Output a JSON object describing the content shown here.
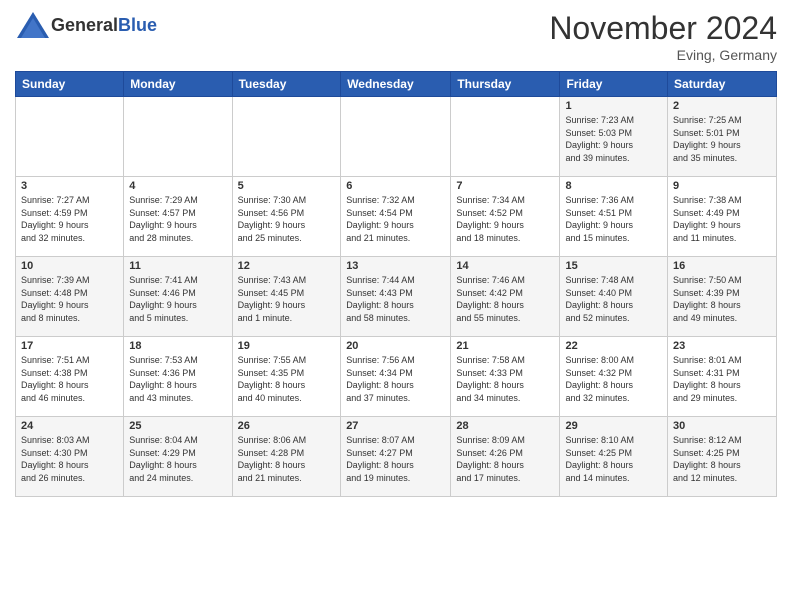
{
  "header": {
    "logo_general": "General",
    "logo_blue": "Blue",
    "month_title": "November 2024",
    "location": "Eving, Germany"
  },
  "days_of_week": [
    "Sunday",
    "Monday",
    "Tuesday",
    "Wednesday",
    "Thursday",
    "Friday",
    "Saturday"
  ],
  "weeks": [
    [
      {
        "day": "",
        "info": ""
      },
      {
        "day": "",
        "info": ""
      },
      {
        "day": "",
        "info": ""
      },
      {
        "day": "",
        "info": ""
      },
      {
        "day": "",
        "info": ""
      },
      {
        "day": "1",
        "info": "Sunrise: 7:23 AM\nSunset: 5:03 PM\nDaylight: 9 hours\nand 39 minutes."
      },
      {
        "day": "2",
        "info": "Sunrise: 7:25 AM\nSunset: 5:01 PM\nDaylight: 9 hours\nand 35 minutes."
      }
    ],
    [
      {
        "day": "3",
        "info": "Sunrise: 7:27 AM\nSunset: 4:59 PM\nDaylight: 9 hours\nand 32 minutes."
      },
      {
        "day": "4",
        "info": "Sunrise: 7:29 AM\nSunset: 4:57 PM\nDaylight: 9 hours\nand 28 minutes."
      },
      {
        "day": "5",
        "info": "Sunrise: 7:30 AM\nSunset: 4:56 PM\nDaylight: 9 hours\nand 25 minutes."
      },
      {
        "day": "6",
        "info": "Sunrise: 7:32 AM\nSunset: 4:54 PM\nDaylight: 9 hours\nand 21 minutes."
      },
      {
        "day": "7",
        "info": "Sunrise: 7:34 AM\nSunset: 4:52 PM\nDaylight: 9 hours\nand 18 minutes."
      },
      {
        "day": "8",
        "info": "Sunrise: 7:36 AM\nSunset: 4:51 PM\nDaylight: 9 hours\nand 15 minutes."
      },
      {
        "day": "9",
        "info": "Sunrise: 7:38 AM\nSunset: 4:49 PM\nDaylight: 9 hours\nand 11 minutes."
      }
    ],
    [
      {
        "day": "10",
        "info": "Sunrise: 7:39 AM\nSunset: 4:48 PM\nDaylight: 9 hours\nand 8 minutes."
      },
      {
        "day": "11",
        "info": "Sunrise: 7:41 AM\nSunset: 4:46 PM\nDaylight: 9 hours\nand 5 minutes."
      },
      {
        "day": "12",
        "info": "Sunrise: 7:43 AM\nSunset: 4:45 PM\nDaylight: 9 hours\nand 1 minute."
      },
      {
        "day": "13",
        "info": "Sunrise: 7:44 AM\nSunset: 4:43 PM\nDaylight: 8 hours\nand 58 minutes."
      },
      {
        "day": "14",
        "info": "Sunrise: 7:46 AM\nSunset: 4:42 PM\nDaylight: 8 hours\nand 55 minutes."
      },
      {
        "day": "15",
        "info": "Sunrise: 7:48 AM\nSunset: 4:40 PM\nDaylight: 8 hours\nand 52 minutes."
      },
      {
        "day": "16",
        "info": "Sunrise: 7:50 AM\nSunset: 4:39 PM\nDaylight: 8 hours\nand 49 minutes."
      }
    ],
    [
      {
        "day": "17",
        "info": "Sunrise: 7:51 AM\nSunset: 4:38 PM\nDaylight: 8 hours\nand 46 minutes."
      },
      {
        "day": "18",
        "info": "Sunrise: 7:53 AM\nSunset: 4:36 PM\nDaylight: 8 hours\nand 43 minutes."
      },
      {
        "day": "19",
        "info": "Sunrise: 7:55 AM\nSunset: 4:35 PM\nDaylight: 8 hours\nand 40 minutes."
      },
      {
        "day": "20",
        "info": "Sunrise: 7:56 AM\nSunset: 4:34 PM\nDaylight: 8 hours\nand 37 minutes."
      },
      {
        "day": "21",
        "info": "Sunrise: 7:58 AM\nSunset: 4:33 PM\nDaylight: 8 hours\nand 34 minutes."
      },
      {
        "day": "22",
        "info": "Sunrise: 8:00 AM\nSunset: 4:32 PM\nDaylight: 8 hours\nand 32 minutes."
      },
      {
        "day": "23",
        "info": "Sunrise: 8:01 AM\nSunset: 4:31 PM\nDaylight: 8 hours\nand 29 minutes."
      }
    ],
    [
      {
        "day": "24",
        "info": "Sunrise: 8:03 AM\nSunset: 4:30 PM\nDaylight: 8 hours\nand 26 minutes."
      },
      {
        "day": "25",
        "info": "Sunrise: 8:04 AM\nSunset: 4:29 PM\nDaylight: 8 hours\nand 24 minutes."
      },
      {
        "day": "26",
        "info": "Sunrise: 8:06 AM\nSunset: 4:28 PM\nDaylight: 8 hours\nand 21 minutes."
      },
      {
        "day": "27",
        "info": "Sunrise: 8:07 AM\nSunset: 4:27 PM\nDaylight: 8 hours\nand 19 minutes."
      },
      {
        "day": "28",
        "info": "Sunrise: 8:09 AM\nSunset: 4:26 PM\nDaylight: 8 hours\nand 17 minutes."
      },
      {
        "day": "29",
        "info": "Sunrise: 8:10 AM\nSunset: 4:25 PM\nDaylight: 8 hours\nand 14 minutes."
      },
      {
        "day": "30",
        "info": "Sunrise: 8:12 AM\nSunset: 4:25 PM\nDaylight: 8 hours\nand 12 minutes."
      }
    ]
  ]
}
